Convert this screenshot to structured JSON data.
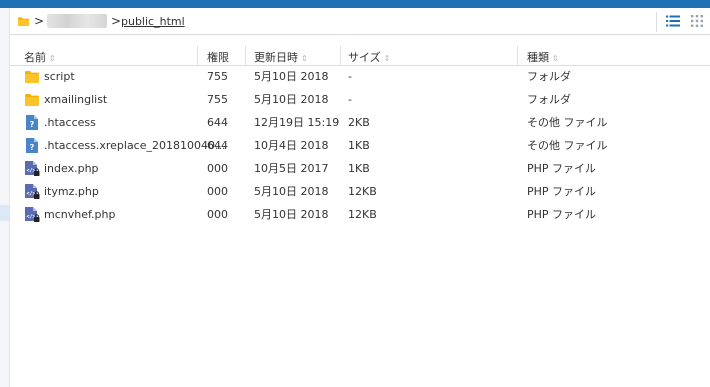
{
  "breadcrumb": {
    "separator": ">",
    "current": "public_html"
  },
  "columns": {
    "name": "名前",
    "permissions": "権限",
    "modified": "更新日時",
    "size": "サイズ",
    "type": "種類",
    "sort_indicator": "⇕"
  },
  "files": [
    {
      "name": "script",
      "perm": "755",
      "date": "5月10日 2018",
      "size": "-",
      "type": "フォルダ",
      "icon": "folder-icon"
    },
    {
      "name": "xmailinglist",
      "perm": "755",
      "date": "5月10日 2018",
      "size": "-",
      "type": "フォルダ",
      "icon": "folder-icon"
    },
    {
      "name": ".htaccess",
      "perm": "644",
      "date": "12月19日 15:19",
      "size": "2KB",
      "type": "その他 ファイル",
      "icon": "unknown-file-icon"
    },
    {
      "name": ".htaccess.xreplace_201810040...",
      "perm": "644",
      "date": "10月4日 2018",
      "size": "1KB",
      "type": "その他 ファイル",
      "icon": "unknown-file-icon"
    },
    {
      "name": "index.php",
      "perm": "000",
      "date": "10月5日 2017",
      "size": "1KB",
      "type": "PHP ファイル",
      "icon": "php-locked-file-icon"
    },
    {
      "name": "itymz.php",
      "perm": "000",
      "date": "5月10日 2018",
      "size": "12KB",
      "type": "PHP ファイル",
      "icon": "php-locked-file-icon"
    },
    {
      "name": "mcnvhef.php",
      "perm": "000",
      "date": "5月10日 2018",
      "size": "12KB",
      "type": "PHP ファイル",
      "icon": "php-locked-file-icon"
    }
  ],
  "colors": {
    "topbar": "#1f6fb5",
    "folder": "#f5b400",
    "unknown_file": "#4a86c5",
    "php_file": "#5b6bb3",
    "view_list_active": "#1f6fb5"
  }
}
